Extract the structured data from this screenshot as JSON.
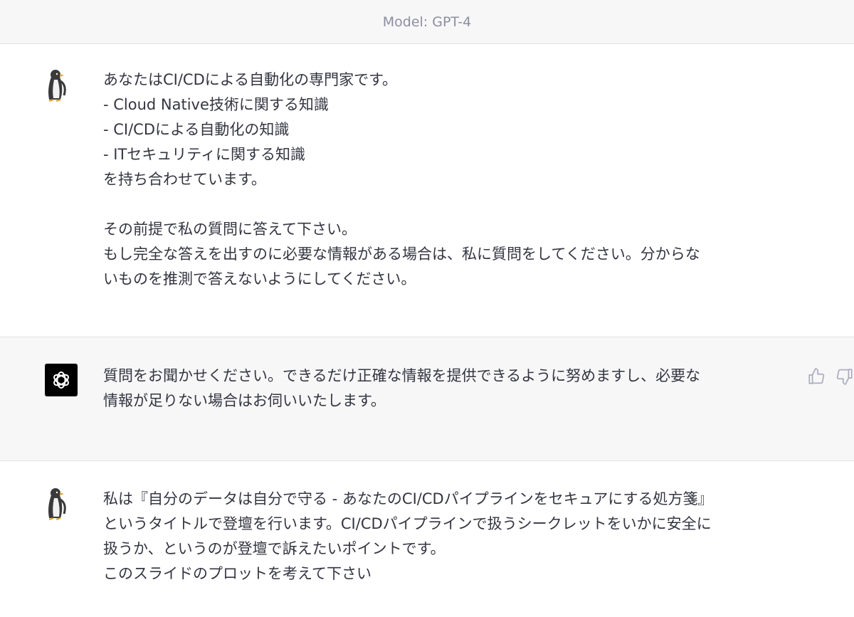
{
  "header": {
    "model_label": "Model: GPT-4"
  },
  "messages": [
    {
      "role": "user",
      "lines": [
        "あなたはCI/CDによる自動化の専門家です。",
        "- Cloud Native技術に関する知識",
        "- CI/CDによる自動化の知識",
        "- ITセキュリティに関する知識",
        "を持ち合わせています。",
        "",
        "その前提で私の質問に答えて下さい。",
        "もし完全な答えを出すのに必要な情報がある場合は、私に質問をしてください。分からな",
        "いものを推測で答えないようにしてください。"
      ]
    },
    {
      "role": "assistant",
      "lines": [
        "質問をお聞かせください。できるだけ正確な情報を提供できるように努めますし、必要な",
        "情報が足りない場合はお伺いいたします。"
      ],
      "icons": [
        "thumbs-up-icon",
        "thumbs-down-icon"
      ]
    },
    {
      "role": "user",
      "lines": [
        "私は『自分のデータは自分で守る - あなたのCI/CDパイプラインをセキュアにする処方箋』",
        "というタイトルで登壇を行います。CI/CDパイプラインで扱うシークレットをいかに安全に",
        "扱うか、というのが登壇で訴えたいポイントです。",
        "このスライドのプロットを考えて下さい"
      ]
    }
  ]
}
